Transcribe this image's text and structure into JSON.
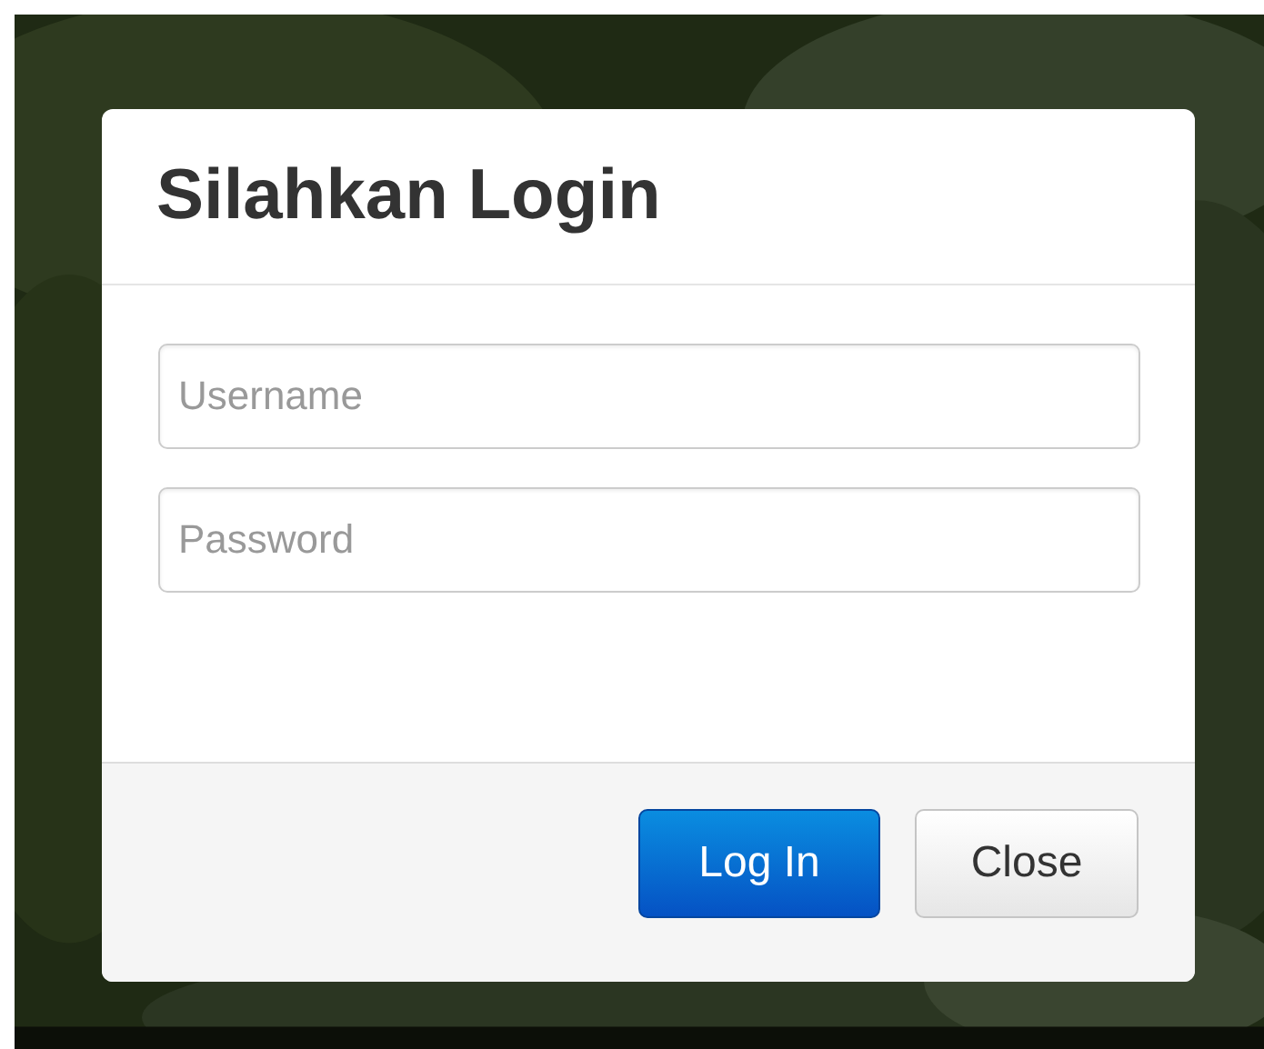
{
  "dialog": {
    "title": "Silahkan Login",
    "fields": [
      {
        "placeholder": "Username"
      },
      {
        "placeholder": "Password"
      }
    ],
    "buttons": [
      {
        "label": "Log In",
        "kind": "primary"
      },
      {
        "label": "Close",
        "kind": "default"
      }
    ]
  }
}
